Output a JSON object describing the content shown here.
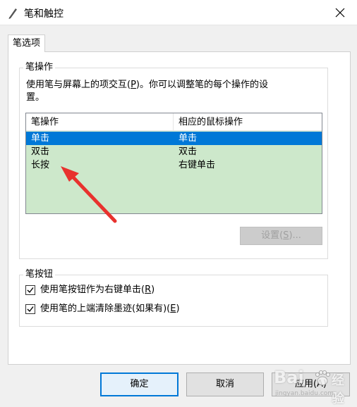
{
  "window": {
    "title": "笔和触控",
    "close_icon": "close-icon"
  },
  "tabs": [
    {
      "label": "笔选项",
      "active": true
    }
  ],
  "pen_actions": {
    "group_title": "笔操作",
    "description": "使用笔与屏幕上的项交互(P)。你可以调整笔的每个操作的设置。",
    "description_line1": "使用笔与屏幕上的项交互(",
    "description_access_key": "P",
    "description_line1_end": ")。你可以调整笔的每个操作的设",
    "description_line2": "置。",
    "columns": [
      "笔操作",
      "相应的鼠标操作"
    ],
    "rows": [
      {
        "action": "单击",
        "mouse": "单击",
        "selected": true
      },
      {
        "action": "双击",
        "mouse": "双击",
        "selected": false
      },
      {
        "action": "长按",
        "mouse": "右键单击",
        "selected": false
      }
    ],
    "settings_button": "设置(S)...",
    "settings_button_pre": "设置(",
    "settings_button_key": "S",
    "settings_button_post": ")..."
  },
  "pen_buttons": {
    "group_title": "笔按钮",
    "options": [
      {
        "label_pre": "使用笔按钮作为右键单击(",
        "key": "R",
        "label_post": ")",
        "checked": true
      },
      {
        "label_pre": "使用笔的上端清除墨迹(如果有)(",
        "key": "E",
        "label_post": ")",
        "checked": true
      }
    ]
  },
  "footer": {
    "ok_label": "确定",
    "cancel_label": "取消",
    "apply_label": "应用(A)"
  },
  "watermark": {
    "main": "Bai",
    "main2": "经验",
    "sub": "jingyan.baidu.com"
  },
  "colors": {
    "selection": "#0078d7",
    "list_bg": "#cde8cb",
    "annotation_arrow": "#e8322e"
  }
}
